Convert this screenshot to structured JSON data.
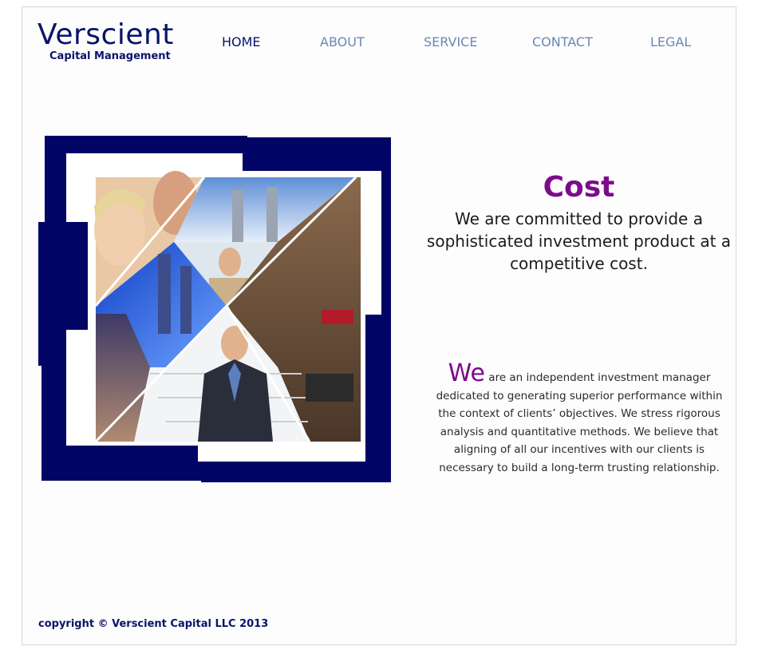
{
  "brand": {
    "name": "Verscient",
    "tagline": "Capital Management"
  },
  "nav": {
    "items": [
      {
        "label": "HOME",
        "active": true
      },
      {
        "label": "ABOUT",
        "active": false
      },
      {
        "label": "SERVICE",
        "active": false
      },
      {
        "label": "CONTACT",
        "active": false
      },
      {
        "label": "LEGAL",
        "active": false
      }
    ]
  },
  "hero": {
    "heading": "Cost",
    "text": "We are committed to provide a sophisticated investment product at a competitive cost."
  },
  "about": {
    "lead_word": "We",
    "text": " are an independent investment manager dedicated to generating superior performance within the context of clients’ objectives. We stress rigorous analysis and quantitative methods. We believe that aligning of all our incentives with our clients is necessary to build a long-term trusting relationship."
  },
  "footer": {
    "copyright": "copyright © Verscient Capital LLC 2013"
  },
  "colors": {
    "brand_navy": "#0a1468",
    "nav_inactive": "#6b87b3",
    "accent_purple": "#7d0a8c"
  }
}
